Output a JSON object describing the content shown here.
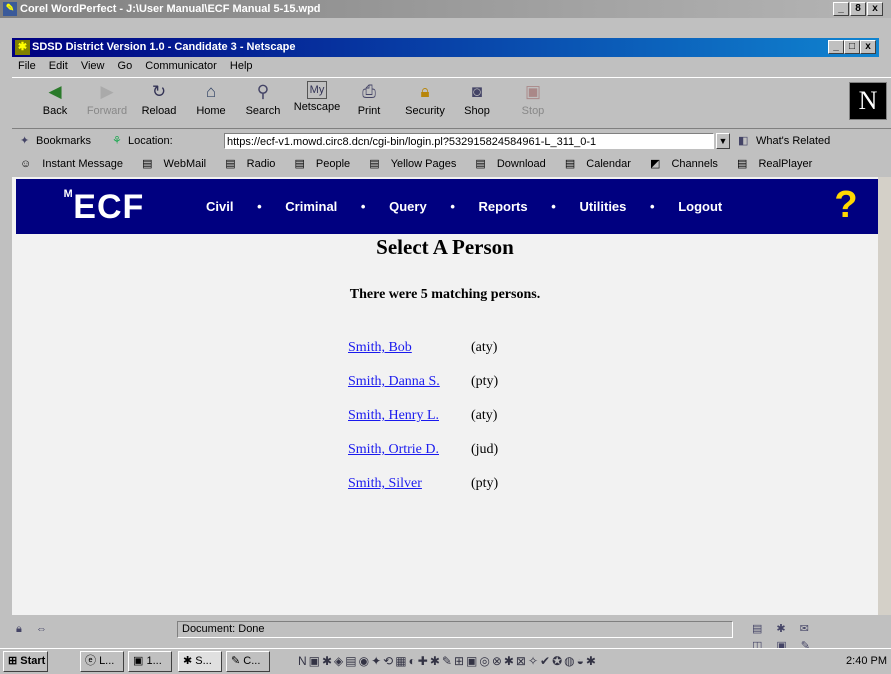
{
  "outer_window": {
    "title": "Corel WordPerfect - J:\\User Manual\\ECF Manual 5-15.wpd",
    "controls": [
      "_",
      "8",
      "x"
    ]
  },
  "browser": {
    "title": "SDSD District Version 1.0 - Candidate 3 - Netscape",
    "controls": [
      "_",
      "□",
      "x"
    ],
    "menu": [
      "File",
      "Edit",
      "View",
      "Go",
      "Communicator",
      "Help"
    ],
    "toolbar": [
      {
        "label": "Back",
        "icon": "back-arrow-icon",
        "enabled": true
      },
      {
        "label": "Forward",
        "icon": "forward-arrow-icon",
        "enabled": false
      },
      {
        "label": "Reload",
        "icon": "reload-icon",
        "enabled": true
      },
      {
        "label": "Home",
        "icon": "home-icon",
        "enabled": true
      },
      {
        "label": "Search",
        "icon": "search-icon",
        "enabled": true
      },
      {
        "label": "Netscape",
        "icon": "netscape-icon",
        "enabled": true
      },
      {
        "label": "Print",
        "icon": "print-icon",
        "enabled": true
      },
      {
        "label": "Security",
        "icon": "lock-icon",
        "enabled": true
      },
      {
        "label": "Shop",
        "icon": "shop-icon",
        "enabled": true
      },
      {
        "label": "Stop",
        "icon": "stop-icon",
        "enabled": false
      }
    ],
    "bookmarks_label": "Bookmarks",
    "location_label": "Location:",
    "url": "https://ecf-v1.mowd.circ8.dcn/cgi-bin/login.pl?532915824584961-L_311_0-1",
    "whats_related": "What's Related",
    "personal_toolbar": [
      "Instant Message",
      "WebMail",
      "Radio",
      "People",
      "Yellow Pages",
      "Download",
      "Calendar",
      "Channels",
      "RealPlayer"
    ],
    "status": "Document: Done"
  },
  "ecf": {
    "logo": "ECF",
    "menu": [
      "Civil",
      "•",
      "Criminal",
      "•",
      "Query",
      "•",
      "Reports",
      "•",
      "Utilities",
      "•",
      "Logout"
    ]
  },
  "page": {
    "title": "Select A Person",
    "subtitle": "There were 5 matching persons.",
    "persons": [
      {
        "name": "Smith, Bob",
        "role": "(aty)"
      },
      {
        "name": "Smith, Danna S.",
        "role": "(pty)"
      },
      {
        "name": "Smith, Henry L.",
        "role": "(aty)"
      },
      {
        "name": "Smith, Ortrie D.",
        "role": "(jud)"
      },
      {
        "name": "Smith, Silver",
        "role": "(pty)"
      }
    ]
  },
  "taskbar": {
    "start": "Start",
    "buttons": [
      "L...",
      "1...",
      "S...",
      "C..."
    ],
    "clock": "2:40 PM"
  }
}
